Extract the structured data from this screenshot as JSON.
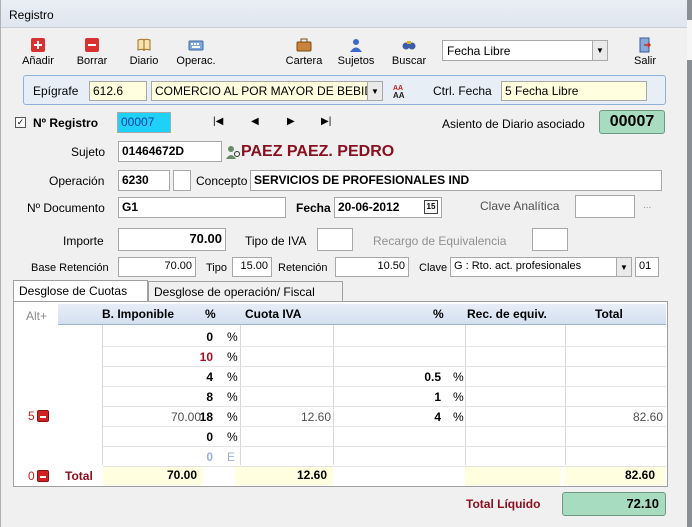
{
  "window": {
    "title": "Registro"
  },
  "toolbar": {
    "anadir": "Añadir",
    "borrar": "Borrar",
    "diario": "Diario",
    "operac": "Operac.",
    "cartera": "Cartera",
    "sujetos": "Sujetos",
    "buscar": "Buscar",
    "fecha_mode": "Fecha Libre",
    "salir": "Salir"
  },
  "epigrafe": {
    "label": "Epígrafe",
    "code": "612.6",
    "desc": "COMERCIO AL POR MAYOR DE BEBID.",
    "ctrl_label": "Ctrl. Fecha",
    "ctrl_value": "5 Fecha Libre"
  },
  "registro": {
    "label": "Nº Registro",
    "value": "00007",
    "asiento_label": "Asiento de Diario asociado",
    "asiento_value": "00007"
  },
  "sujeto": {
    "label": "Sujeto",
    "nif": "01464672D",
    "name": "PAEZ PAEZ. PEDRO"
  },
  "operacion": {
    "label": "Operación",
    "code": "6230",
    "concepto_label": "Concepto",
    "concepto": "SERVICIOS DE PROFESIONALES IND"
  },
  "documento": {
    "label": "Nº Documento",
    "value": "G1",
    "fecha_label": "Fecha",
    "fecha": "20-06-2012",
    "cal": "15",
    "clave_label": "Clave Analítica"
  },
  "importe": {
    "label": "Importe",
    "value": "70.00",
    "tipo_iva_label": "Tipo de IVA",
    "recargo_label": "Recargo de Equivalencia"
  },
  "retencion": {
    "base_label": "Base Retención",
    "base": "70.00",
    "tipo_label": "Tipo",
    "tipo": "15.00",
    "ret_label": "Retención",
    "ret": "10.50",
    "clave_label": "Clave",
    "clave": "G : Rto. act. profesionales",
    "clave_code": "01"
  },
  "tabs": {
    "cuotas": "Desglose de Cuotas",
    "fiscal": "Desglose de operación/ Fiscal"
  },
  "grid": {
    "alt": "Alt+",
    "headers": {
      "base": "B. Imponible",
      "pct": "%",
      "cuota": "Cuota IVA",
      "pct2": "%",
      "rec": "Rec. de equiv.",
      "total": "Total"
    },
    "rows": [
      {
        "base": "",
        "pct": "0",
        "sym": "%",
        "cuota": "",
        "rpct": "",
        "rsym": "",
        "total": ""
      },
      {
        "base": "",
        "pct": "10",
        "sym": "%",
        "cuota": "",
        "rpct": "",
        "rsym": "",
        "total": ""
      },
      {
        "base": "",
        "pct": "4",
        "sym": "%",
        "cuota": "",
        "rpct": "0.5",
        "rsym": "%",
        "total": ""
      },
      {
        "base": "",
        "pct": "8",
        "sym": "%",
        "cuota": "",
        "rpct": "1",
        "rsym": "%",
        "total": ""
      },
      {
        "base": "70.00",
        "pct": "18",
        "sym": "%",
        "cuota": "12.60",
        "rpct": "4",
        "rsym": "%",
        "total": "82.60"
      },
      {
        "base": "",
        "pct": "0",
        "sym": "%",
        "cuota": "",
        "rpct": "",
        "rsym": "",
        "total": ""
      },
      {
        "base": "",
        "pct": "0",
        "sym": "E",
        "cuota": "",
        "rpct": "",
        "rsym": "",
        "total": ""
      }
    ],
    "row_counter": "5",
    "total_counter": "0",
    "total_label": "Total",
    "total_base": "70.00",
    "total_cuota": "12.60",
    "total_total": "82.60"
  },
  "liquido": {
    "label": "Total Líquido",
    "value": "72.10"
  }
}
